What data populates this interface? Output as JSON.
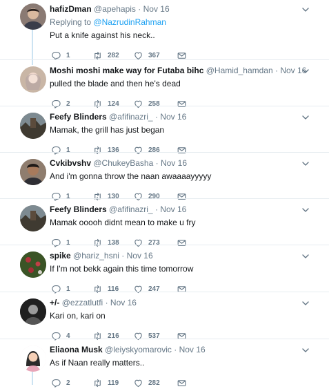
{
  "tweets": [
    {
      "name": "hafizDman",
      "handle": "@apehapis",
      "time": "Nov 16",
      "reply_prefix": "Replying to",
      "reply_to": "@NazrudinRahman",
      "text": "Put a knife against his neck..",
      "replies": "1",
      "retweets": "282",
      "likes": "367",
      "avatar_color": "#8a7a73"
    },
    {
      "name": "Moshi moshi make way for Futaba bihc",
      "handle": "@Hamid_hamdan",
      "time": "Nov 16",
      "text": "pulled the blade and then he's dead",
      "replies": "2",
      "retweets": "124",
      "likes": "258",
      "avatar_color": "#c9b6a6"
    },
    {
      "name": "Feefy Blinders",
      "handle": "@afifinazri_",
      "time": "Nov 16",
      "text": "Mamak, the grill has just began",
      "replies": "1",
      "retweets": "136",
      "likes": "286",
      "avatar_color": "#5d5a4e"
    },
    {
      "name": "Cvkibvshv",
      "handle": "@ChukeyBasha",
      "time": "Nov 16",
      "text": "And i'm gonna throw the naan awaaaayyyyy",
      "replies": "1",
      "retweets": "130",
      "likes": "290",
      "avatar_color": "#6b5445"
    },
    {
      "name": "Feefy Blinders",
      "handle": "@afifinazri_",
      "time": "Nov 16",
      "text": "Mamak ooooh didnt mean to make u fry",
      "replies": "1",
      "retweets": "138",
      "likes": "273",
      "avatar_color": "#5d5a4e"
    },
    {
      "name": "spike",
      "handle": "@hariz_hsni",
      "time": "Nov 16",
      "text": "If I'm not bekk again this time tomorrow",
      "replies": "1",
      "retweets": "116",
      "likes": "247",
      "avatar_color": "#3f5a2d"
    },
    {
      "name": "+/-",
      "handle": "@ezzatlutfi",
      "time": "Nov 16",
      "text": "Kari on, kari on",
      "replies": "4",
      "retweets": "216",
      "likes": "537",
      "avatar_color": "#2b2b2b"
    },
    {
      "name": "Eliaona Musk",
      "handle": "@leiyskyomarovic",
      "time": "Nov 16",
      "text": "As if Naan really matters..",
      "replies": "2",
      "retweets": "119",
      "likes": "282",
      "avatar_color": "#f4dde3"
    }
  ],
  "separator": "·",
  "colors": {
    "accent": "#1da1f2",
    "muted": "#657786",
    "thread": "#cce3f2"
  },
  "icons": [
    "reply-icon",
    "retweet-icon",
    "like-icon",
    "message-icon",
    "chevron-down-icon"
  ]
}
